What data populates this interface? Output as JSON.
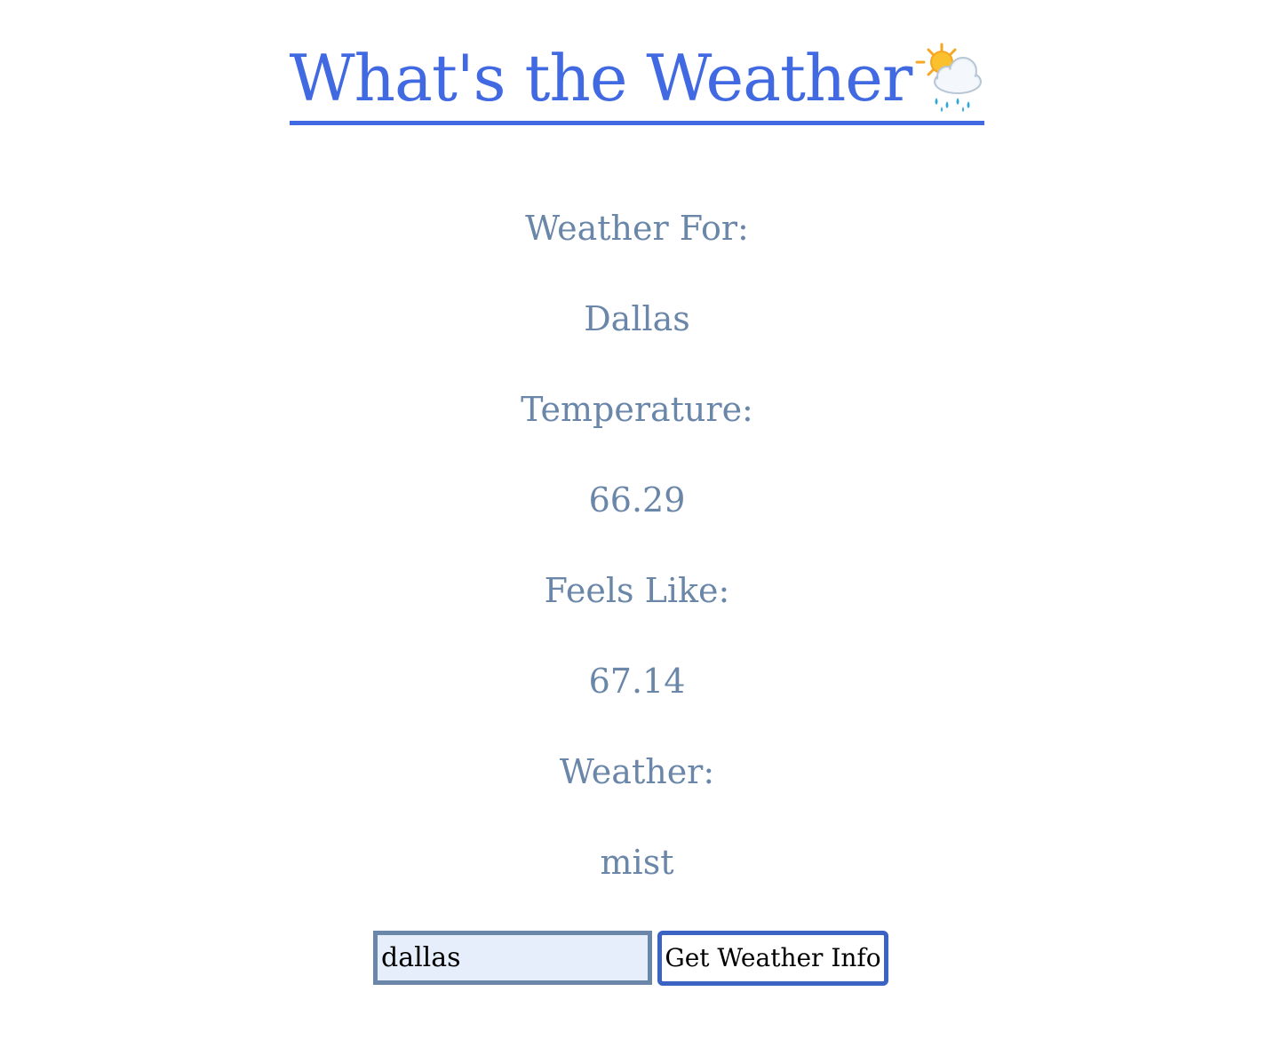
{
  "header": {
    "title": "What's the Weather",
    "icon": "sun-behind-rain-cloud-icon"
  },
  "weather": {
    "location_label": "Weather For:",
    "location_value": "Dallas",
    "temperature_label": "Temperature:",
    "temperature_value": "66.29",
    "feels_like_label": "Feels Like:",
    "feels_like_value": "67.14",
    "conditions_label": "Weather:",
    "conditions_value": "mist"
  },
  "form": {
    "city_value": "dallas",
    "submit_label": "Get Weather Info"
  },
  "colors": {
    "title": "#4169e1",
    "text": "#6a86a8",
    "input_bg": "#e7eefb",
    "input_border": "#6a86a8",
    "button_border": "#3a63c4"
  }
}
